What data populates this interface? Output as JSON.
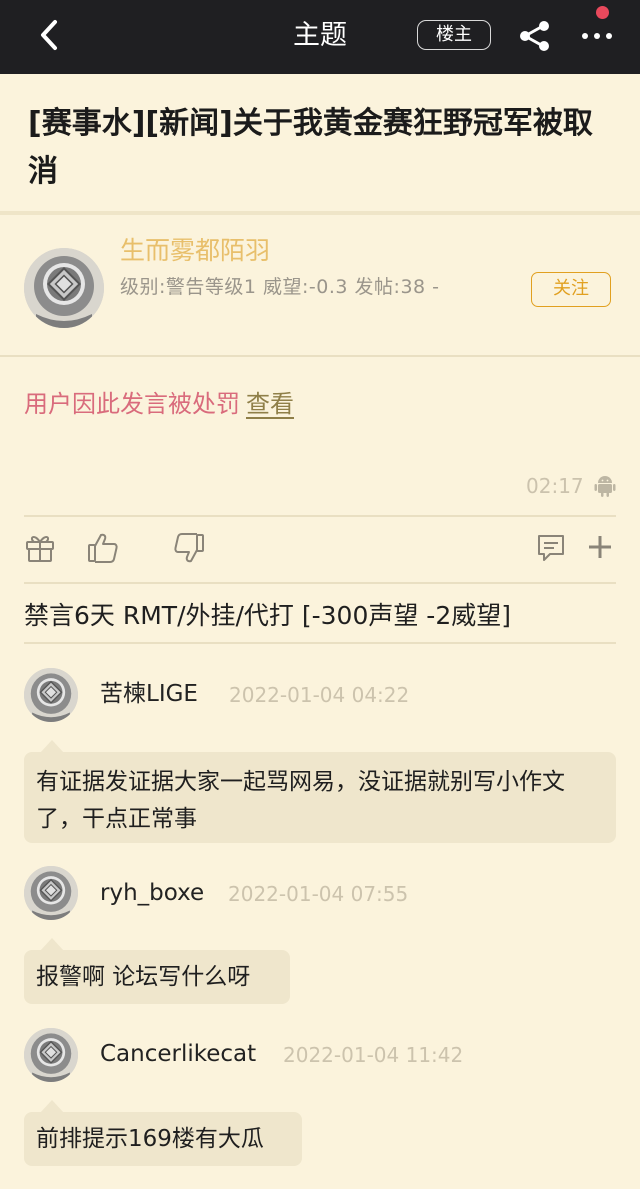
{
  "topbar": {
    "title": "主题",
    "op_badge": "楼主",
    "icons": [
      "back-icon",
      "share-icon",
      "more-icon"
    ]
  },
  "post": {
    "title": "[赛事水][新闻]关于我黄金赛狂野冠军被取消",
    "author": {
      "name": "生而雾都陌羽",
      "meta": "级别:警告等级1 威望:-0.3 发帖:38 -",
      "follow_label": "关注"
    },
    "penalty_notice": "用户因此发言被处罚",
    "penalty_link": "查看",
    "time": "02:17",
    "platform_icon": "android-icon"
  },
  "actions": [
    "gift-icon",
    "like-icon",
    "dislike-icon",
    "comment-icon",
    "plus-icon"
  ],
  "ban_text": "禁言6天 RMT/外挂/代打 [-300声望 -2威望]",
  "comments": [
    {
      "user": "苦楝LIGE",
      "time": "2022-01-04 04:22",
      "text": "有证据发证据大家一起骂网易，没证据就别写小作文了，干点正常事"
    },
    {
      "user": "ryh_boxe",
      "time": "2022-01-04 07:55",
      "text": "报警啊 论坛写什么呀"
    },
    {
      "user": "Cancerlikecat",
      "time": "2022-01-04 11:42",
      "text": "前排提示169楼有大瓜"
    }
  ],
  "colors": {
    "background": "#fbf3dc",
    "topbar": "#1f1f22",
    "author_name": "#e8bf6b",
    "follow": "#e1a020",
    "penalty": "#d96b7c",
    "bubble": "#efe6cc",
    "notification_dot": "#e8495c"
  }
}
